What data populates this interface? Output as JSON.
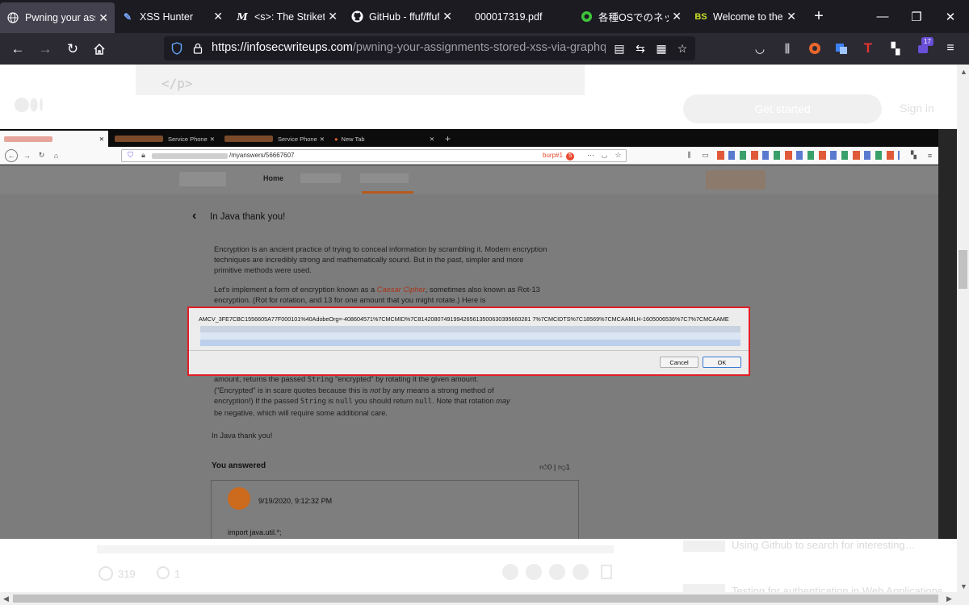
{
  "browser": {
    "tabs": [
      {
        "title": "Pwning your assig",
        "icon": "globe-icon",
        "active": true
      },
      {
        "title": "XSS Hunter",
        "icon": "pen-icon",
        "active": false
      },
      {
        "title": "<s>: The Strikethr",
        "icon": "mdn-icon",
        "active": false
      },
      {
        "title": "GitHub - ffuf/ffuf:",
        "icon": "github-icon",
        "active": false
      },
      {
        "title": "000017319.pdf",
        "icon": "",
        "active": false
      },
      {
        "title": "各種OSでのネットワ",
        "icon": "green-circle-icon",
        "active": false
      },
      {
        "title": "Welcome to the B",
        "icon": "bs-icon",
        "active": false
      }
    ],
    "url_host": "https://infosecwriteups.com",
    "url_path": "/pwning-your-assignments-stored-xss-via-graphql-endpo",
    "extension_badge": "17"
  },
  "article": {
    "code_fragment": "</p>",
    "cta_label": "Get started",
    "signin_label": "Sign in",
    "bottom_applause": "319",
    "bottom_responses": "1",
    "sidebar_link": "Using Github to search for interesting…",
    "sidebar_link_2": "Testing for authentication in Web Applications"
  },
  "inner": {
    "tabs": [
      {
        "title": "Service Phone"
      },
      {
        "title": "Service Phone"
      },
      {
        "title": "New Tab"
      }
    ],
    "url_path": "/myanswers/56667607",
    "burp_label": "burp#1",
    "burp_count": "5",
    "site_nav_home": "Home",
    "question_title": "In Java thank you!",
    "para1": "Encryption is an ancient practice of trying to conceal information by scrambling it. Modern encryption techniques are incredibly strong and mathematically sound. But in the past, simpler and more primitive methods were used.",
    "para2_pre": "Let's implement a form of encryption known as a ",
    "para2_link": "Caesar Cipher",
    "para2_post": ", sometimes also known as Rot-13 encryption. (Rot for rotation, and 13 for one amount that you might rotate.) Here is",
    "para3_line1_pre": "amount, returns the passed ",
    "para3_line1_code": "String",
    "para3_line1_post": " \"encrypted\" by rotating it the given amount.",
    "para3_line2": "(\"Encrypted\" is in scare quotes because this is ",
    "para3_line2_em": "not",
    "para3_line2_post": " by any means a strong method of",
    "para3_line3_pre": "encryption!) If the passed ",
    "para3_line3_code1": "String",
    "para3_line3_mid": " is ",
    "para3_line3_code2": "null",
    "para3_line3_mid2": " you should return ",
    "para3_line3_code3": "null",
    "para3_line3_post": ". Note that rotation ",
    "para3_line3_em": "may",
    "para3_line4": "be negative, which will require some additional care.",
    "closing": "In Java thank you!",
    "dialog_text": "AMCV_3FE7CBC1556605A77F000101%40AdobeOrg=-408604571%7CMCMID%7C81420807491994265613500630395660281 7%7CMCIDTS%7C18569%7CMCAAMLH-1605006536%7C7%7CMCAAME",
    "dialog_cancel": "Cancel",
    "dialog_ok": "OK",
    "you_answered": "You answered",
    "upvotes": "0",
    "downvotes": "1",
    "answer_time": "9/19/2020, 9:12:32 PM",
    "answer_code": "import java.util.*;"
  },
  "colors": {
    "accent_red": "#e11f26",
    "burp_orange": "#e8492e",
    "caesar_link": "#a8341a"
  }
}
